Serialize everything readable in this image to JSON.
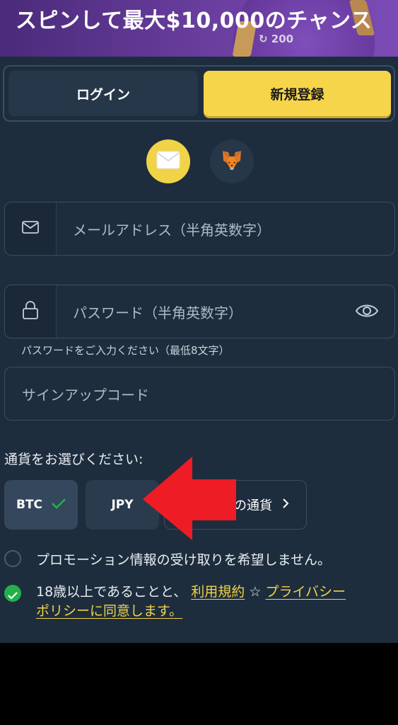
{
  "banner": {
    "title": "スピンして最大$10,000のチャンス",
    "counter": "200"
  },
  "tabs": {
    "login": "ログイン",
    "register": "新規登録"
  },
  "signup_methods": {
    "email_icon": "envelope-icon",
    "wallet_icon": "metamask-fox-icon"
  },
  "form": {
    "email_placeholder": "メールアドレス（半角英数字）",
    "password_placeholder": "パスワード（半角英数字）",
    "password_hint": "パスワードをご入力ください（最低8文字）",
    "signup_code_placeholder": "サインアップコード"
  },
  "currency": {
    "label": "通貨をお選びください:",
    "options": [
      "BTC",
      "JPY"
    ],
    "selected": "BTC",
    "other_label": "の通貨"
  },
  "promo": {
    "label": "プロモーション情報の受け取りを希望しません。",
    "checked": false
  },
  "terms": {
    "prefix": "18歳以上であることと、",
    "terms_link": "利用規約",
    "separator": "☆",
    "privacy_link_part1": "プライバシー",
    "privacy_link_part2": "ポリシーに同意します。",
    "checked": true
  },
  "colors": {
    "accent": "#f1d347",
    "panel": "#1e2d3d",
    "check_green": "#22b04b",
    "arrow_red": "#ee1c24"
  }
}
